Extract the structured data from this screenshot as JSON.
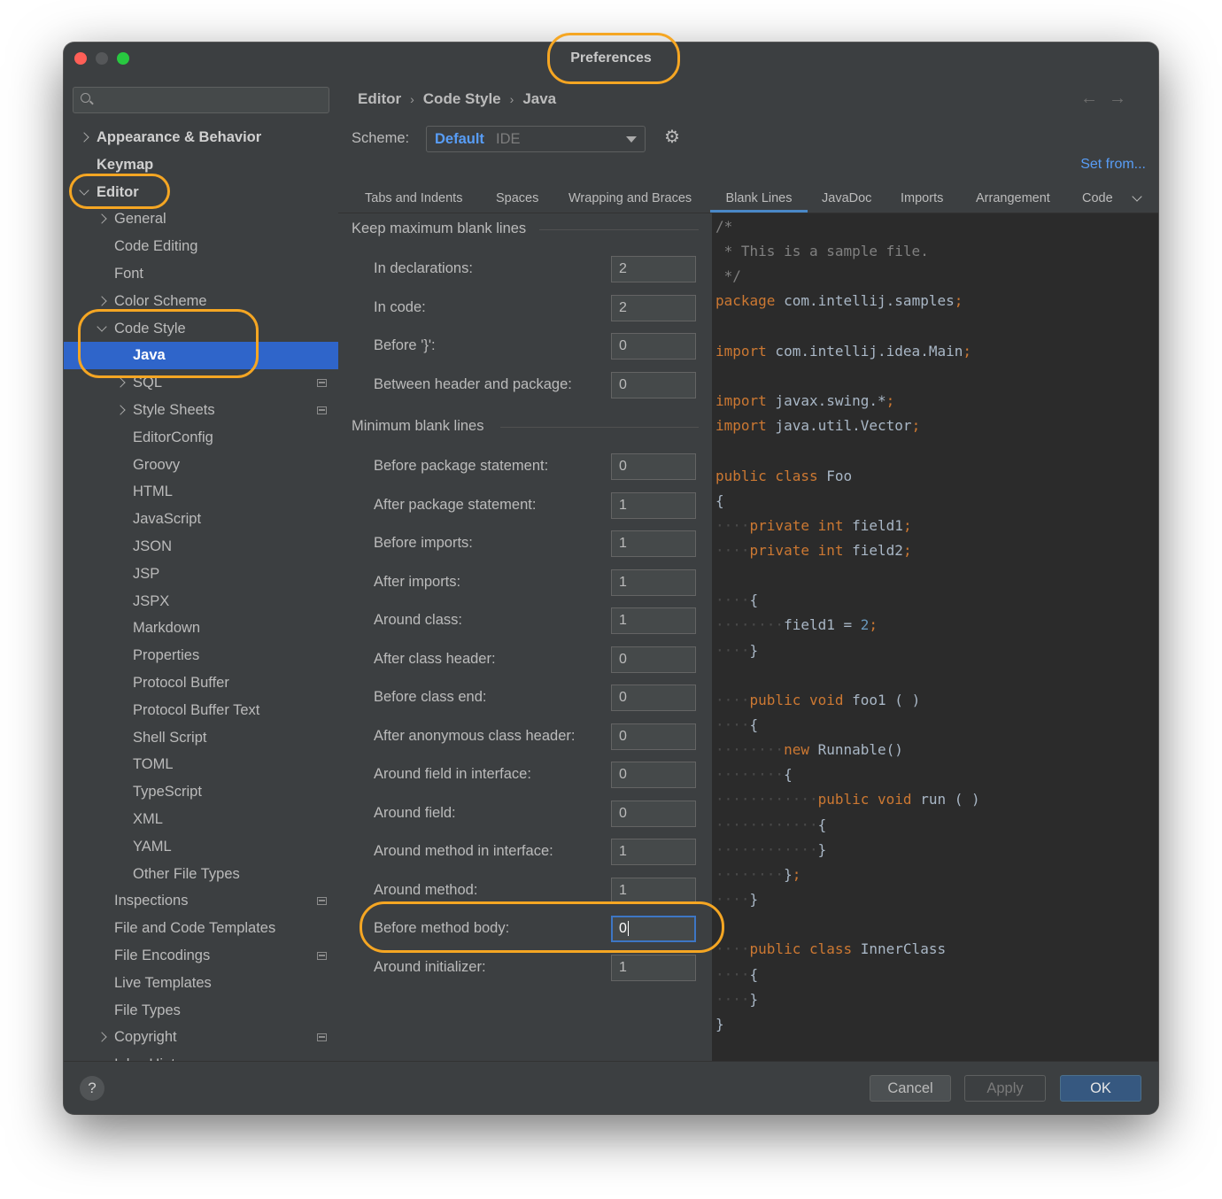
{
  "window": {
    "title": "Preferences"
  },
  "sidebar": {
    "search_placeholder": "",
    "items": [
      {
        "label": "Appearance & Behavior",
        "level": 0,
        "expander": "collapsed",
        "bold": true
      },
      {
        "label": "Keymap",
        "level": 0,
        "expander": "none",
        "bold": true
      },
      {
        "label": "Editor",
        "level": 0,
        "expander": "expanded",
        "bold": true
      },
      {
        "label": "General",
        "level": 1,
        "expander": "collapsed"
      },
      {
        "label": "Code Editing",
        "level": 1,
        "expander": "none"
      },
      {
        "label": "Font",
        "level": 1,
        "expander": "none"
      },
      {
        "label": "Color Scheme",
        "level": 1,
        "expander": "collapsed"
      },
      {
        "label": "Code Style",
        "level": 1,
        "expander": "expanded"
      },
      {
        "label": "Java",
        "level": 2,
        "expander": "none",
        "selected": true
      },
      {
        "label": "SQL",
        "level": 2,
        "expander": "collapsed",
        "project": true
      },
      {
        "label": "Style Sheets",
        "level": 2,
        "expander": "collapsed",
        "project": true
      },
      {
        "label": "EditorConfig",
        "level": 2,
        "expander": "none"
      },
      {
        "label": "Groovy",
        "level": 2,
        "expander": "none"
      },
      {
        "label": "HTML",
        "level": 2,
        "expander": "none"
      },
      {
        "label": "JavaScript",
        "level": 2,
        "expander": "none"
      },
      {
        "label": "JSON",
        "level": 2,
        "expander": "none"
      },
      {
        "label": "JSP",
        "level": 2,
        "expander": "none"
      },
      {
        "label": "JSPX",
        "level": 2,
        "expander": "none"
      },
      {
        "label": "Markdown",
        "level": 2,
        "expander": "none"
      },
      {
        "label": "Properties",
        "level": 2,
        "expander": "none"
      },
      {
        "label": "Protocol Buffer",
        "level": 2,
        "expander": "none"
      },
      {
        "label": "Protocol Buffer Text",
        "level": 2,
        "expander": "none"
      },
      {
        "label": "Shell Script",
        "level": 2,
        "expander": "none"
      },
      {
        "label": "TOML",
        "level": 2,
        "expander": "none"
      },
      {
        "label": "TypeScript",
        "level": 2,
        "expander": "none"
      },
      {
        "label": "XML",
        "level": 2,
        "expander": "none"
      },
      {
        "label": "YAML",
        "level": 2,
        "expander": "none"
      },
      {
        "label": "Other File Types",
        "level": 2,
        "expander": "none"
      },
      {
        "label": "Inspections",
        "level": 1,
        "expander": "none",
        "project": true
      },
      {
        "label": "File and Code Templates",
        "level": 1,
        "expander": "none"
      },
      {
        "label": "File Encodings",
        "level": 1,
        "expander": "none",
        "project": true
      },
      {
        "label": "Live Templates",
        "level": 1,
        "expander": "none"
      },
      {
        "label": "File Types",
        "level": 1,
        "expander": "none"
      },
      {
        "label": "Copyright",
        "level": 1,
        "expander": "collapsed",
        "project": true
      },
      {
        "label": "Inlay Hints",
        "level": 1,
        "expander": "none",
        "project": true
      }
    ]
  },
  "breadcrumb": [
    "Editor",
    "Code Style",
    "Java"
  ],
  "nav": {
    "back": "←",
    "forward": "→"
  },
  "scheme": {
    "label": "Scheme:",
    "value": "Default",
    "suffix": "IDE",
    "set_from": "Set from..."
  },
  "tabs": [
    {
      "label": "Tabs and Indents",
      "active": false
    },
    {
      "label": "Spaces",
      "active": false
    },
    {
      "label": "Wrapping and Braces",
      "active": false
    },
    {
      "label": "Blank Lines",
      "active": true
    },
    {
      "label": "JavaDoc",
      "active": false
    },
    {
      "label": "Imports",
      "active": false
    },
    {
      "label": "Arrangement",
      "active": false
    },
    {
      "label": "Code",
      "active": false
    }
  ],
  "settings": {
    "keep_max_title": "Keep maximum blank lines",
    "keep_max": [
      {
        "label": "In declarations:",
        "value": "2"
      },
      {
        "label": "In code:",
        "value": "2"
      },
      {
        "label": "Before '}':",
        "value": "0"
      },
      {
        "label": "Between header and package:",
        "value": "0"
      }
    ],
    "min_title": "Minimum blank lines",
    "min": [
      {
        "label": "Before package statement:",
        "value": "0"
      },
      {
        "label": "After package statement:",
        "value": "1"
      },
      {
        "label": "Before imports:",
        "value": "1"
      },
      {
        "label": "After imports:",
        "value": "1"
      },
      {
        "label": "Around class:",
        "value": "1"
      },
      {
        "label": "After class header:",
        "value": "0"
      },
      {
        "label": "Before class end:",
        "value": "0"
      },
      {
        "label": "After anonymous class header:",
        "value": "0"
      },
      {
        "label": "Around field in interface:",
        "value": "0"
      },
      {
        "label": "Around field:",
        "value": "0"
      },
      {
        "label": "Around method in interface:",
        "value": "1"
      },
      {
        "label": "Around method:",
        "value": "1"
      },
      {
        "label": "Before method body:",
        "value": "0",
        "focused": true
      },
      {
        "label": "Around initializer:",
        "value": "1"
      }
    ]
  },
  "preview_lines": [
    [
      [
        "cm",
        "/*"
      ]
    ],
    [
      [
        "cm",
        " * This is a sample file."
      ]
    ],
    [
      [
        "cm",
        " */"
      ]
    ],
    [
      [
        "kw",
        "package"
      ],
      [
        "t",
        " com.intellij.samples"
      ],
      [
        "kw",
        ";"
      ]
    ],
    [],
    [
      [
        "kw",
        "import"
      ],
      [
        "t",
        " com.intellij.idea.Main"
      ],
      [
        "kw",
        ";"
      ]
    ],
    [],
    [
      [
        "kw",
        "import"
      ],
      [
        "t",
        " javax.swing.*"
      ],
      [
        "kw",
        ";"
      ]
    ],
    [
      [
        "kw",
        "import"
      ],
      [
        "t",
        " java.util.Vector"
      ],
      [
        "kw",
        ";"
      ]
    ],
    [],
    [
      [
        "kw",
        "public class"
      ],
      [
        "t",
        " Foo"
      ]
    ],
    [
      [
        "t",
        "{"
      ]
    ],
    [
      [
        "dots",
        "····"
      ],
      [
        "kw",
        "private int"
      ],
      [
        "t",
        " field1"
      ],
      [
        "kw",
        ";"
      ]
    ],
    [
      [
        "dots",
        "····"
      ],
      [
        "kw",
        "private int"
      ],
      [
        "t",
        " field2"
      ],
      [
        "kw",
        ";"
      ]
    ],
    [],
    [
      [
        "dots",
        "····"
      ],
      [
        "t",
        "{"
      ]
    ],
    [
      [
        "dots",
        "········"
      ],
      [
        "t",
        "field1 = "
      ],
      [
        "num",
        "2"
      ],
      [
        "kw",
        ";"
      ]
    ],
    [
      [
        "dots",
        "····"
      ],
      [
        "t",
        "}"
      ]
    ],
    [],
    [
      [
        "dots",
        "····"
      ],
      [
        "kw",
        "public void"
      ],
      [
        "t",
        " foo1 ( )"
      ]
    ],
    [
      [
        "dots",
        "····"
      ],
      [
        "t",
        "{"
      ]
    ],
    [
      [
        "dots",
        "········"
      ],
      [
        "kw",
        "new"
      ],
      [
        "t",
        " Runnable()"
      ]
    ],
    [
      [
        "dots",
        "········"
      ],
      [
        "t",
        "{"
      ]
    ],
    [
      [
        "dots",
        "············"
      ],
      [
        "kw",
        "public void"
      ],
      [
        "t",
        " run ( )"
      ]
    ],
    [
      [
        "dots",
        "············"
      ],
      [
        "t",
        "{"
      ]
    ],
    [
      [
        "dots",
        "············"
      ],
      [
        "t",
        "}"
      ]
    ],
    [
      [
        "dots",
        "········"
      ],
      [
        "t",
        "}"
      ],
      [
        "kw",
        ";"
      ]
    ],
    [
      [
        "dots",
        "····"
      ],
      [
        "t",
        "}"
      ]
    ],
    [],
    [
      [
        "dots",
        "····"
      ],
      [
        "kw",
        "public class"
      ],
      [
        "t",
        " InnerClass"
      ]
    ],
    [
      [
        "dots",
        "····"
      ],
      [
        "t",
        "{"
      ]
    ],
    [
      [
        "dots",
        "····"
      ],
      [
        "t",
        "}"
      ]
    ],
    [
      [
        "t",
        "}"
      ]
    ]
  ],
  "footer": {
    "help": "?",
    "cancel": "Cancel",
    "apply": "Apply",
    "ok": "OK"
  },
  "colors": {
    "accent": "#2f65ca",
    "annotation": "#f5a623",
    "keyword": "#cc7832",
    "comment": "#808080",
    "number": "#6897bb"
  }
}
